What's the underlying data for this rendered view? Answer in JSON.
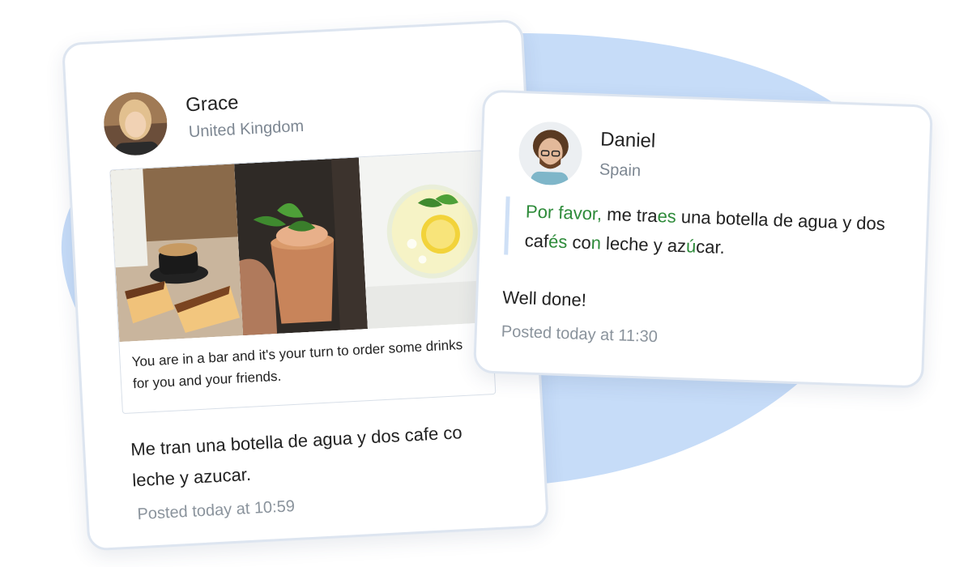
{
  "grace": {
    "name": "Grace",
    "country": "United Kingdom",
    "prompt": "You are in a bar and it's your turn to order some drinks for you and your friends.",
    "message": "Me tran una botella de agua y dos cafe co leche y azucar.",
    "posted": "Posted today at 10:59",
    "photos": [
      "coffee-and-cake-photo",
      "copper-cocktail-photo",
      "lemon-water-photo"
    ]
  },
  "daniel": {
    "name": "Daniel",
    "country": "Spain",
    "correction_parts": [
      {
        "text": "Por favor,",
        "highlight": true
      },
      {
        "text": " me tra",
        "highlight": false
      },
      {
        "text": "es",
        "highlight": true
      },
      {
        "text": " una botella de agua y dos caf",
        "highlight": false
      },
      {
        "text": "és",
        "highlight": true
      },
      {
        "text": " co",
        "highlight": false
      },
      {
        "text": "n",
        "highlight": true
      },
      {
        "text": " leche y az",
        "highlight": false
      },
      {
        "text": "ú",
        "highlight": true
      },
      {
        "text": "car.",
        "highlight": false
      }
    ],
    "message": "Well done!",
    "posted": "Posted today at 11:30"
  },
  "colors": {
    "accent_blob": "#c6dcf8",
    "correction_green": "#2e8b3a",
    "quote_bar": "#cfe0f6",
    "muted_text": "#8a939c"
  }
}
